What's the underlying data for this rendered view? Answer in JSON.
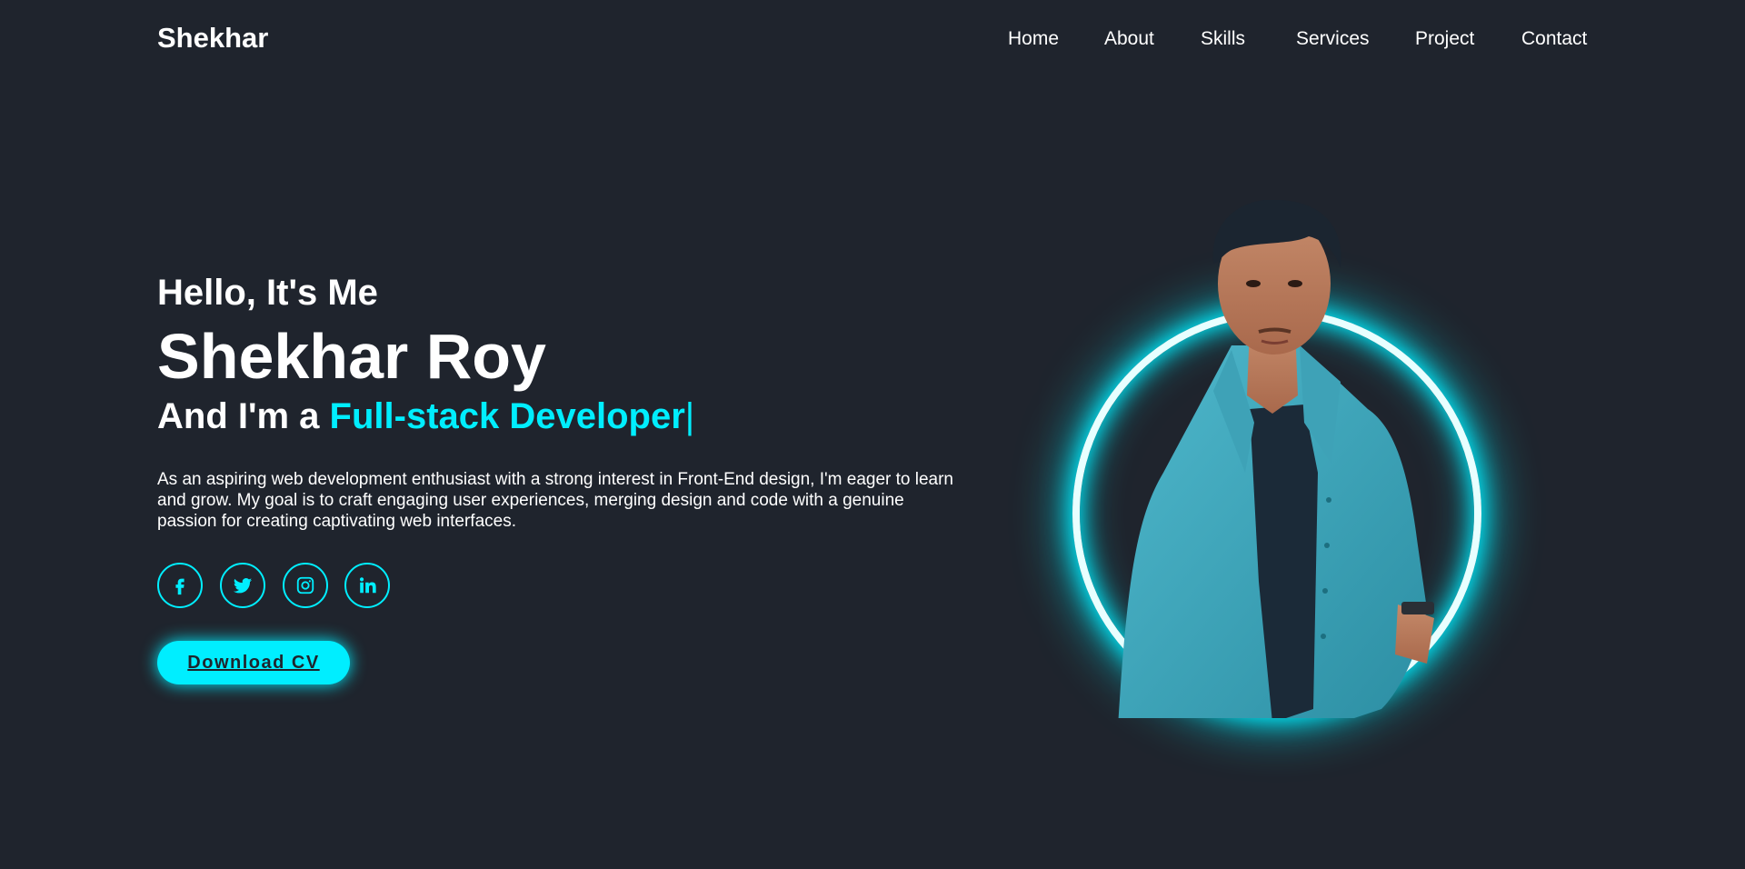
{
  "header": {
    "logo": "Shekhar",
    "nav": [
      "Home",
      "About",
      "Skills",
      "Services",
      "Project",
      "Contact"
    ]
  },
  "hero": {
    "greeting": "Hello, It's Me",
    "name": "Shekhar Roy",
    "role_prefix": "And I'm a ",
    "role_highlight": "Full-stack Developer",
    "role_cursor": "|",
    "bio": "As an aspiring web development enthusiast with a strong interest in Front-End design, I'm eager to learn and grow. My goal is to craft engaging user experiences, merging design and code with a genuine passion for creating captivating web interfaces.",
    "cta": "Download CV"
  },
  "socials": [
    {
      "icon": "facebook-icon"
    },
    {
      "icon": "twitter-icon"
    },
    {
      "icon": "instagram-icon"
    },
    {
      "icon": "linkedin-icon"
    }
  ],
  "theme": {
    "background": "#1f242d",
    "accent": "#00eeff",
    "text": "#ffffff"
  }
}
